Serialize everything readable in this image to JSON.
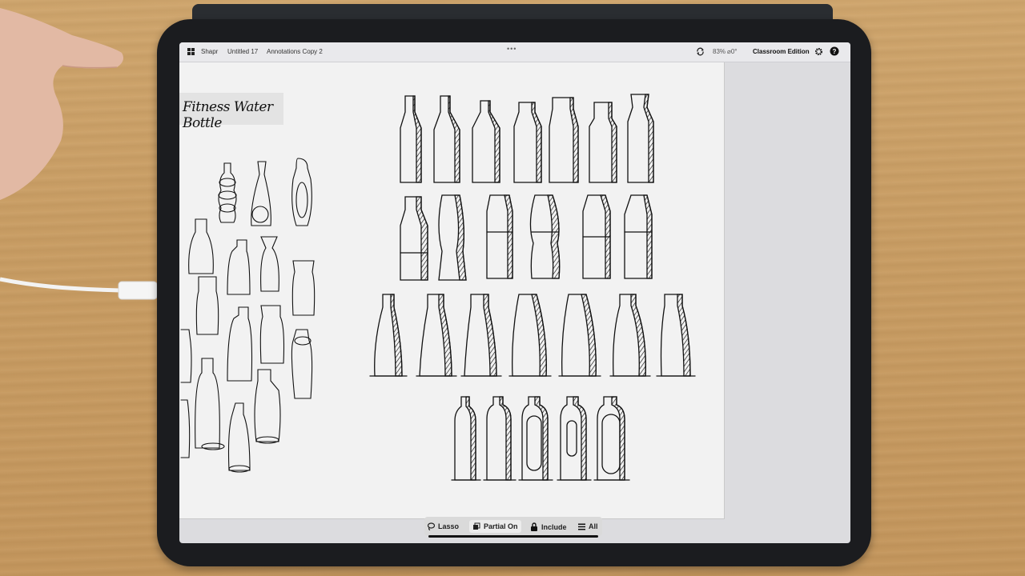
{
  "topbar": {
    "app_name": "Shapr",
    "doc_name": "Untitled 17",
    "sketch_name": "Annotations Copy 2",
    "more_label": "•••",
    "zoom": "83%",
    "angle": "⌀0°",
    "edition": "Classroom Edition"
  },
  "canvas": {
    "sketch_title": "Fitness Water Bottle"
  },
  "toolbar": {
    "lasso": "Lasso",
    "partial": "Partial On",
    "include": "Include",
    "all": "All"
  },
  "icons": [
    "grid-icon",
    "sync-icon",
    "gear-icon",
    "help-icon",
    "lasso-icon",
    "partial-icon",
    "lock-icon",
    "list-icon"
  ],
  "colors": {
    "screen": "#f2f2f2",
    "bezel": "#1b1c1f",
    "ink": "#111111",
    "toolbar": "#dadada"
  }
}
